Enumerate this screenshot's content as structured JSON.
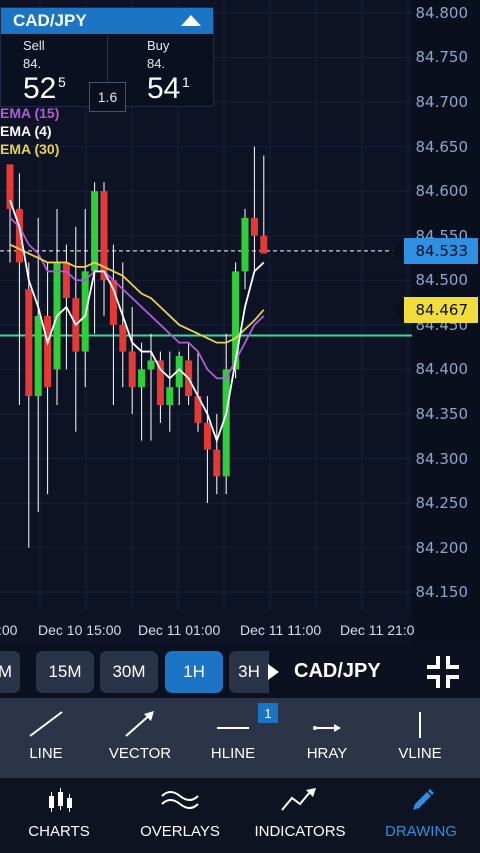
{
  "quote": {
    "symbol": "CAD/JPY",
    "sell_label": "Sell",
    "sell_prefix": "84.",
    "sell_main": "52",
    "sell_sup": "5",
    "buy_label": "Buy",
    "buy_prefix": "84.",
    "buy_main": "54",
    "buy_sup": "1",
    "spread": "1.6"
  },
  "indicators": [
    {
      "label": "EMA (15)",
      "color": "#b45ad6"
    },
    {
      "label": "EMA (4)",
      "color": "#ffffff"
    },
    {
      "label": "EMA (30)",
      "color": "#e8d24a"
    }
  ],
  "price_axis": [
    "84.800",
    "84.750",
    "84.700",
    "84.650",
    "84.600",
    "84.550",
    "84.500",
    "84.450",
    "84.400",
    "84.350",
    "84.300",
    "84.250",
    "84.200",
    "84.150"
  ],
  "price_tags": {
    "current": {
      "value": "84.533",
      "color": "#2f8fe0"
    },
    "ema30": {
      "value": "84.467",
      "color": "#f0dc3a"
    }
  },
  "time_axis": [
    ":00",
    "Dec 10 15:00",
    "Dec 11 01:00",
    "Dec 11 11:00",
    "Dec 11 21:0"
  ],
  "timeframes": {
    "prev": "M",
    "items": [
      "15M",
      "30M",
      "1H",
      "3H"
    ],
    "active": "1H"
  },
  "chart_symbol": "CAD/JPY",
  "drawing_tools": {
    "badge_count": "1",
    "items": [
      "LINE",
      "VECTOR",
      "HLINE",
      "HRAY",
      "VLINE"
    ]
  },
  "nav": {
    "items": [
      "CHARTS",
      "OVERLAYS",
      "INDICATORS",
      "DRAWING"
    ],
    "active": "DRAWING",
    "active_color": "#2f8fe0"
  },
  "chart_data": {
    "type": "candlestick",
    "ylim": [
      84.13,
      84.81
    ],
    "support_line": 84.438,
    "current_price": 84.533,
    "candles": [
      {
        "o": 84.63,
        "h": 84.63,
        "l": 84.52,
        "c": 84.58
      },
      {
        "o": 84.58,
        "h": 84.62,
        "l": 84.36,
        "c": 84.52
      },
      {
        "o": 84.49,
        "h": 84.52,
        "l": 84.2,
        "c": 84.37
      },
      {
        "o": 84.37,
        "h": 84.57,
        "l": 84.24,
        "c": 84.46
      },
      {
        "o": 84.46,
        "h": 84.52,
        "l": 84.26,
        "c": 84.38
      },
      {
        "o": 84.4,
        "h": 84.58,
        "l": 84.36,
        "c": 84.52
      },
      {
        "o": 84.52,
        "h": 84.54,
        "l": 84.4,
        "c": 84.48
      },
      {
        "o": 84.48,
        "h": 84.56,
        "l": 84.33,
        "c": 84.42
      },
      {
        "o": 84.42,
        "h": 84.58,
        "l": 84.38,
        "c": 84.51
      },
      {
        "o": 84.51,
        "h": 84.61,
        "l": 84.44,
        "c": 84.6
      },
      {
        "o": 84.6,
        "h": 84.61,
        "l": 84.46,
        "c": 84.5
      },
      {
        "o": 84.5,
        "h": 84.54,
        "l": 84.36,
        "c": 84.45
      },
      {
        "o": 84.45,
        "h": 84.52,
        "l": 84.38,
        "c": 84.42
      },
      {
        "o": 84.42,
        "h": 84.47,
        "l": 84.35,
        "c": 84.38
      },
      {
        "o": 84.38,
        "h": 84.43,
        "l": 84.32,
        "c": 84.4
      },
      {
        "o": 84.4,
        "h": 84.44,
        "l": 84.32,
        "c": 84.41
      },
      {
        "o": 84.41,
        "h": 84.42,
        "l": 84.34,
        "c": 84.36
      },
      {
        "o": 84.36,
        "h": 84.42,
        "l": 84.33,
        "c": 84.38
      },
      {
        "o": 84.38,
        "h": 84.42,
        "l": 84.36,
        "c": 84.415
      },
      {
        "o": 84.41,
        "h": 84.43,
        "l": 84.36,
        "c": 84.37
      },
      {
        "o": 84.37,
        "h": 84.42,
        "l": 84.33,
        "c": 84.34
      },
      {
        "o": 84.34,
        "h": 84.37,
        "l": 84.25,
        "c": 84.31
      },
      {
        "o": 84.31,
        "h": 84.35,
        "l": 84.26,
        "c": 84.28
      },
      {
        "o": 84.28,
        "h": 84.44,
        "l": 84.26,
        "c": 84.4
      },
      {
        "o": 84.4,
        "h": 84.52,
        "l": 84.39,
        "c": 84.51
      },
      {
        "o": 84.51,
        "h": 84.58,
        "l": 84.49,
        "c": 84.57
      },
      {
        "o": 84.57,
        "h": 84.65,
        "l": 84.51,
        "c": 84.55
      },
      {
        "o": 84.55,
        "h": 84.64,
        "l": 84.53,
        "c": 84.53
      }
    ],
    "ema4": [
      84.59,
      84.56,
      84.5,
      84.47,
      84.43,
      84.46,
      84.47,
      84.45,
      84.46,
      84.51,
      84.51,
      84.49,
      84.46,
      84.43,
      84.42,
      84.42,
      84.4,
      84.39,
      84.4,
      84.39,
      84.37,
      84.35,
      84.32,
      84.35,
      84.41,
      84.47,
      84.51,
      84.52
    ],
    "ema15": [
      84.57,
      84.56,
      84.54,
      84.53,
      84.51,
      84.51,
      84.51,
      84.5,
      84.5,
      84.51,
      84.51,
      84.5,
      84.49,
      84.48,
      84.47,
      84.46,
      84.45,
      84.44,
      84.43,
      84.43,
      84.42,
      84.4,
      84.39,
      84.39,
      84.41,
      84.43,
      84.45,
      84.46
    ],
    "ema30": [
      84.54,
      84.535,
      84.53,
      84.525,
      84.52,
      84.52,
      84.52,
      84.515,
      84.515,
      84.52,
      84.515,
      84.51,
      84.505,
      84.495,
      84.485,
      84.48,
      84.47,
      84.46,
      84.45,
      84.445,
      84.44,
      84.435,
      84.43,
      84.43,
      84.435,
      84.445,
      84.455,
      84.467
    ]
  }
}
